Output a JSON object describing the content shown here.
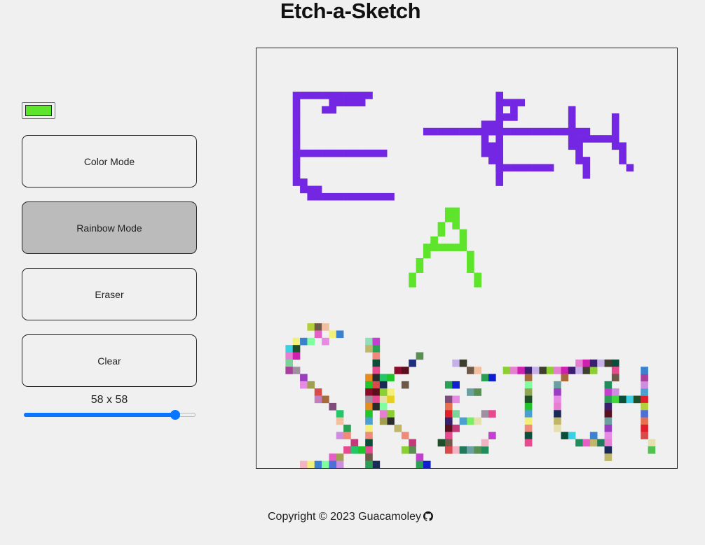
{
  "header": {
    "title": "Etch-a-Sketch"
  },
  "controls": {
    "color_value": "#5ee52b",
    "color_mode_label": "Color Mode",
    "rainbow_mode_label": "Rainbow Mode",
    "eraser_label": "Eraser",
    "clear_label": "Clear",
    "active_mode": "rainbow",
    "grid_size_label": "58 x 58",
    "grid_size": 58,
    "grid_size_min": 1,
    "grid_size_max": 64
  },
  "colors": {
    "purple": "#7427e3",
    "green": "#5ee52b",
    "background": "#f0f0f0",
    "slider_accent": "#0a75ff"
  },
  "grid": {
    "size": 58,
    "strokes": [
      {
        "color": "#7427e3",
        "cells": [
          [
            5,
            6
          ],
          [
            6,
            6
          ],
          [
            7,
            6
          ],
          [
            8,
            6
          ],
          [
            9,
            6
          ],
          [
            10,
            6
          ],
          [
            11,
            6
          ],
          [
            12,
            6
          ],
          [
            13,
            6
          ],
          [
            14,
            6
          ],
          [
            15,
            6
          ],
          [
            5,
            7
          ],
          [
            5,
            8
          ],
          [
            5,
            9
          ],
          [
            5,
            10
          ],
          [
            5,
            11
          ],
          [
            5,
            12
          ],
          [
            5,
            13
          ],
          [
            5,
            14
          ],
          [
            5,
            15
          ],
          [
            5,
            16
          ],
          [
            5,
            17
          ],
          [
            5,
            18
          ],
          [
            6,
            18
          ],
          [
            6,
            19
          ],
          [
            7,
            19
          ],
          [
            8,
            19
          ],
          [
            7,
            20
          ],
          [
            8,
            20
          ],
          [
            9,
            20
          ],
          [
            10,
            20
          ],
          [
            11,
            20
          ],
          [
            12,
            20
          ],
          [
            13,
            20
          ],
          [
            14,
            20
          ],
          [
            15,
            20
          ],
          [
            16,
            20
          ],
          [
            17,
            20
          ],
          [
            18,
            20
          ],
          [
            6,
            14
          ],
          [
            7,
            14
          ],
          [
            8,
            14
          ],
          [
            9,
            14
          ],
          [
            10,
            14
          ],
          [
            11,
            14
          ],
          [
            12,
            14
          ],
          [
            13,
            14
          ],
          [
            14,
            14
          ],
          [
            15,
            14
          ],
          [
            16,
            14
          ],
          [
            17,
            14
          ],
          [
            9,
            8
          ],
          [
            10,
            8
          ],
          [
            10,
            7
          ],
          [
            11,
            7
          ],
          [
            12,
            7
          ],
          [
            13,
            7
          ],
          [
            14,
            7
          ],
          [
            23,
            11
          ],
          [
            24,
            11
          ],
          [
            25,
            11
          ],
          [
            26,
            11
          ],
          [
            27,
            11
          ],
          [
            28,
            11
          ],
          [
            29,
            11
          ],
          [
            30,
            11
          ],
          [
            31,
            11
          ],
          [
            32,
            11
          ],
          [
            33,
            11
          ],
          [
            34,
            11
          ],
          [
            35,
            11
          ],
          [
            36,
            11
          ],
          [
            37,
            11
          ],
          [
            38,
            11
          ],
          [
            39,
            11
          ],
          [
            40,
            11
          ],
          [
            41,
            11
          ],
          [
            42,
            11
          ],
          [
            43,
            11
          ],
          [
            44,
            11
          ],
          [
            45,
            11
          ],
          [
            33,
            6
          ],
          [
            33,
            7
          ],
          [
            33,
            8
          ],
          [
            33,
            9
          ],
          [
            33,
            10
          ],
          [
            33,
            12
          ],
          [
            33,
            13
          ],
          [
            33,
            14
          ],
          [
            33,
            15
          ],
          [
            33,
            16
          ],
          [
            33,
            17
          ],
          [
            33,
            18
          ],
          [
            34,
            7
          ],
          [
            35,
            7
          ],
          [
            36,
            7
          ],
          [
            35,
            8
          ],
          [
            35,
            9
          ],
          [
            34,
            9
          ],
          [
            33,
            9
          ],
          [
            32,
            10
          ],
          [
            33,
            10
          ],
          [
            31,
            10
          ],
          [
            31,
            11
          ],
          [
            32,
            11
          ],
          [
            31,
            12
          ],
          [
            31,
            13
          ],
          [
            32,
            13
          ],
          [
            31,
            14
          ],
          [
            32,
            14
          ],
          [
            32,
            15
          ],
          [
            33,
            15
          ],
          [
            33,
            16
          ],
          [
            34,
            16
          ],
          [
            35,
            16
          ],
          [
            36,
            16
          ],
          [
            37,
            16
          ],
          [
            38,
            16
          ],
          [
            39,
            16
          ],
          [
            40,
            16
          ],
          [
            43,
            8
          ],
          [
            43,
            9
          ],
          [
            43,
            10
          ],
          [
            43,
            11
          ],
          [
            43,
            12
          ],
          [
            43,
            13
          ],
          [
            44,
            12
          ],
          [
            45,
            12
          ],
          [
            46,
            12
          ],
          [
            47,
            12
          ],
          [
            48,
            12
          ],
          [
            49,
            12
          ],
          [
            49,
            11
          ],
          [
            49,
            10
          ],
          [
            49,
            9
          ],
          [
            49,
            13
          ],
          [
            50,
            13
          ],
          [
            50,
            14
          ],
          [
            50,
            15
          ],
          [
            51,
            16
          ],
          [
            45,
            15
          ],
          [
            45,
            16
          ],
          [
            45,
            17
          ],
          [
            44,
            13
          ],
          [
            44,
            14
          ],
          [
            44,
            15
          ]
        ]
      },
      {
        "color": "#5ee52b",
        "cells": [
          [
            26,
            22
          ],
          [
            27,
            22
          ],
          [
            26,
            23
          ],
          [
            27,
            23
          ],
          [
            25,
            24
          ],
          [
            27,
            24
          ],
          [
            25,
            25
          ],
          [
            28,
            25
          ],
          [
            24,
            26
          ],
          [
            28,
            26
          ],
          [
            23,
            27
          ],
          [
            24,
            27
          ],
          [
            25,
            27
          ],
          [
            26,
            27
          ],
          [
            27,
            27
          ],
          [
            28,
            27
          ],
          [
            23,
            28
          ],
          [
            29,
            28
          ],
          [
            22,
            29
          ],
          [
            29,
            29
          ],
          [
            22,
            30
          ],
          [
            29,
            30
          ],
          [
            21,
            31
          ],
          [
            30,
            31
          ],
          [
            21,
            32
          ],
          [
            30,
            32
          ]
        ]
      }
    ],
    "rainbow_cells": [
      [
        7,
        38
      ],
      [
        8,
        38
      ],
      [
        9,
        38
      ],
      [
        8,
        39
      ],
      [
        10,
        39
      ],
      [
        11,
        39
      ],
      [
        5,
        40
      ],
      [
        6,
        40
      ],
      [
        7,
        40
      ],
      [
        9,
        40
      ],
      [
        4,
        41
      ],
      [
        5,
        41
      ],
      [
        4,
        42
      ],
      [
        5,
        42
      ],
      [
        4,
        43
      ],
      [
        4,
        44
      ],
      [
        5,
        44
      ],
      [
        6,
        45
      ],
      [
        6,
        46
      ],
      [
        7,
        46
      ],
      [
        8,
        47
      ],
      [
        8,
        48
      ],
      [
        9,
        48
      ],
      [
        10,
        49
      ],
      [
        11,
        50
      ],
      [
        11,
        51
      ],
      [
        12,
        52
      ],
      [
        11,
        53
      ],
      [
        12,
        53
      ],
      [
        13,
        54
      ],
      [
        12,
        55
      ],
      [
        13,
        55
      ],
      [
        14,
        55
      ],
      [
        11,
        56
      ],
      [
        10,
        56
      ],
      [
        11,
        57
      ],
      [
        6,
        57
      ],
      [
        7,
        57
      ],
      [
        8,
        57
      ],
      [
        9,
        57
      ],
      [
        10,
        57
      ],
      [
        15,
        40
      ],
      [
        16,
        40
      ],
      [
        16,
        41
      ],
      [
        15,
        41
      ],
      [
        16,
        42
      ],
      [
        16,
        43
      ],
      [
        16,
        44
      ],
      [
        15,
        45
      ],
      [
        16,
        45
      ],
      [
        15,
        46
      ],
      [
        16,
        46
      ],
      [
        15,
        47
      ],
      [
        16,
        47
      ],
      [
        15,
        48
      ],
      [
        16,
        48
      ],
      [
        15,
        49
      ],
      [
        16,
        49
      ],
      [
        15,
        50
      ],
      [
        15,
        51
      ],
      [
        15,
        52
      ],
      [
        15,
        53
      ],
      [
        15,
        54
      ],
      [
        15,
        55
      ],
      [
        15,
        56
      ],
      [
        17,
        45
      ],
      [
        18,
        45
      ],
      [
        17,
        46
      ],
      [
        18,
        47
      ],
      [
        17,
        48
      ],
      [
        18,
        48
      ],
      [
        17,
        49
      ],
      [
        18,
        50
      ],
      [
        18,
        51
      ],
      [
        17,
        51
      ],
      [
        19,
        52
      ],
      [
        20,
        53
      ],
      [
        21,
        54
      ],
      [
        21,
        55
      ],
      [
        20,
        55
      ],
      [
        22,
        56
      ],
      [
        22,
        57
      ],
      [
        23,
        57
      ],
      [
        16,
        57
      ],
      [
        15,
        57
      ],
      [
        19,
        44
      ],
      [
        20,
        44
      ],
      [
        21,
        43
      ],
      [
        22,
        42
      ],
      [
        20,
        46
      ],
      [
        17,
        47
      ],
      [
        17,
        50
      ],
      [
        27,
        43
      ],
      [
        28,
        43
      ],
      [
        29,
        44
      ],
      [
        30,
        44
      ],
      [
        31,
        45
      ],
      [
        32,
        45
      ],
      [
        26,
        46
      ],
      [
        27,
        46
      ],
      [
        29,
        47
      ],
      [
        30,
        47
      ],
      [
        26,
        48
      ],
      [
        27,
        48
      ],
      [
        26,
        49
      ],
      [
        26,
        50
      ],
      [
        27,
        50
      ],
      [
        26,
        51
      ],
      [
        26,
        52
      ],
      [
        27,
        52
      ],
      [
        26,
        53
      ],
      [
        26,
        54
      ],
      [
        25,
        54
      ],
      [
        27,
        55
      ],
      [
        26,
        55
      ],
      [
        28,
        55
      ],
      [
        29,
        55
      ],
      [
        30,
        55
      ],
      [
        31,
        55
      ],
      [
        32,
        53
      ],
      [
        31,
        54
      ],
      [
        29,
        51
      ],
      [
        28,
        51
      ],
      [
        30,
        51
      ],
      [
        31,
        50
      ],
      [
        32,
        50
      ],
      [
        34,
        44
      ],
      [
        35,
        44
      ],
      [
        36,
        44
      ],
      [
        37,
        44
      ],
      [
        38,
        44
      ],
      [
        39,
        44
      ],
      [
        40,
        44
      ],
      [
        41,
        44
      ],
      [
        42,
        44
      ],
      [
        43,
        44
      ],
      [
        44,
        44
      ],
      [
        45,
        44
      ],
      [
        46,
        44
      ],
      [
        37,
        45
      ],
      [
        37,
        46
      ],
      [
        37,
        47
      ],
      [
        37,
        48
      ],
      [
        37,
        49
      ],
      [
        37,
        50
      ],
      [
        37,
        51
      ],
      [
        37,
        52
      ],
      [
        37,
        53
      ],
      [
        37,
        54
      ],
      [
        44,
        43
      ],
      [
        45,
        43
      ],
      [
        46,
        43
      ],
      [
        47,
        43
      ],
      [
        48,
        43
      ],
      [
        42,
        45
      ],
      [
        41,
        46
      ],
      [
        41,
        47
      ],
      [
        41,
        48
      ],
      [
        41,
        49
      ],
      [
        41,
        50
      ],
      [
        41,
        51
      ],
      [
        41,
        52
      ],
      [
        42,
        53
      ],
      [
        43,
        53
      ],
      [
        44,
        54
      ],
      [
        45,
        54
      ],
      [
        46,
        54
      ],
      [
        47,
        54
      ],
      [
        46,
        53
      ],
      [
        49,
        43
      ],
      [
        49,
        44
      ],
      [
        49,
        45
      ],
      [
        48,
        46
      ],
      [
        48,
        47
      ],
      [
        48,
        48
      ],
      [
        48,
        49
      ],
      [
        48,
        50
      ],
      [
        48,
        51
      ],
      [
        48,
        52
      ],
      [
        48,
        53
      ],
      [
        48,
        54
      ],
      [
        48,
        55
      ],
      [
        48,
        56
      ],
      [
        49,
        47
      ],
      [
        49,
        48
      ],
      [
        50,
        48
      ],
      [
        51,
        48
      ],
      [
        52,
        48
      ],
      [
        53,
        48
      ],
      [
        53,
        47
      ],
      [
        53,
        46
      ],
      [
        53,
        45
      ],
      [
        53,
        44
      ],
      [
        53,
        49
      ],
      [
        53,
        50
      ],
      [
        53,
        51
      ],
      [
        53,
        52
      ],
      [
        53,
        53
      ],
      [
        54,
        54
      ],
      [
        54,
        55
      ]
    ],
    "rainbow_palette": [
      "#7f4b7a",
      "#e84a8f",
      "#9a3dbf",
      "#3bcfe3",
      "#5a8f53",
      "#8fa653",
      "#e88a1d",
      "#4c6fd8",
      "#8bcf32",
      "#6f5a4a",
      "#e68ae3",
      "#23c76a",
      "#8fe0b8",
      "#1f4f2a",
      "#1e8f5a",
      "#e6704f",
      "#2b2b2b",
      "#8f8f2b",
      "#e67fd0",
      "#f0c0a0",
      "#a0a050",
      "#21c42b",
      "#c23fd0",
      "#e01f2a",
      "#e65fc6",
      "#7bee61",
      "#1a2a57",
      "#f3b3c3",
      "#d020b0",
      "#4aa0d0",
      "#2aa055",
      "#d94a4a",
      "#c9a04a",
      "#7bd39a",
      "#c0b66a",
      "#ce8ee0",
      "#8b0b2b",
      "#f3f07a",
      "#3b1f6f",
      "#c27fbf",
      "#0f1fcf",
      "#a83f9a",
      "#e6e0b0",
      "#3fd83a",
      "#1e7a5a",
      "#f08a7a",
      "#5a0f1f",
      "#3c80d0",
      "#c6b0e8",
      "#a76a3a",
      "#52c152",
      "#9f8f9f",
      "#e6d020",
      "#0b4f3a",
      "#6aa0a0",
      "#1f2f7f",
      "#c33a7a",
      "#80ffa0",
      "#3f3f2f",
      "#b2d03a"
    ]
  },
  "footer": {
    "copyright": "Copyright © 2023 Guacamoley"
  }
}
